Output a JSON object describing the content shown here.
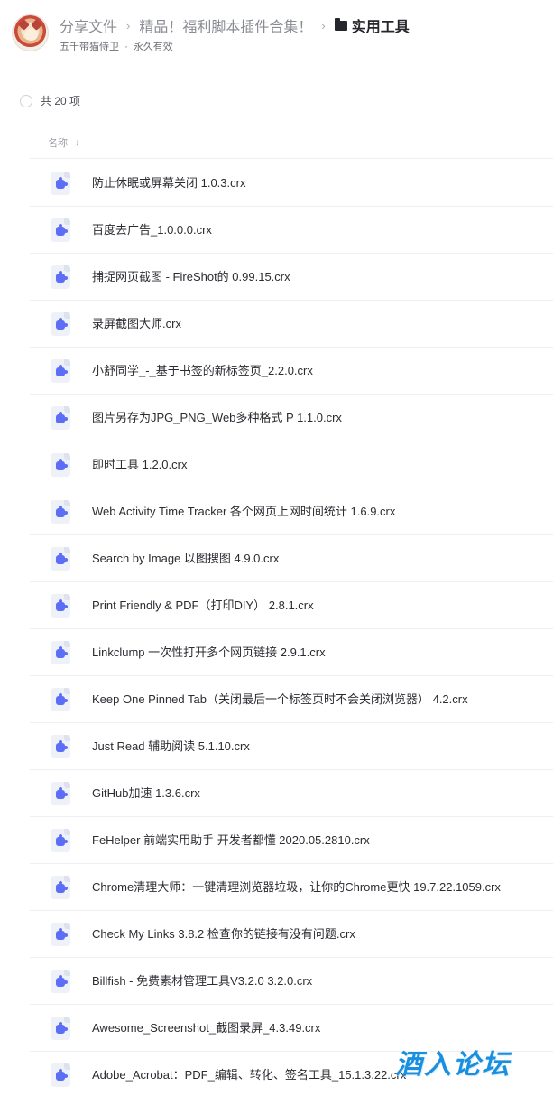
{
  "breadcrumb": {
    "items": [
      "分享文件",
      "精品！福利脚本插件合集！"
    ],
    "separator": "›",
    "current": "实用工具"
  },
  "owner": {
    "name": "五千带猫侍卫",
    "dot": "·",
    "validity": "永久有效"
  },
  "summary": {
    "count_label": "共 20 项"
  },
  "columns": {
    "name_label": "名称",
    "sort_icon": "↓"
  },
  "files": [
    {
      "name": "防止休眠或屏幕关闭 1.0.3.crx"
    },
    {
      "name": "百度去广告_1.0.0.0.crx"
    },
    {
      "name": "捕捉网页截图 - FireShot的 0.99.15.crx"
    },
    {
      "name": "录屏截图大师.crx"
    },
    {
      "name": "小舒同学_-_基于书签的新标签页_2.2.0.crx"
    },
    {
      "name": "图片另存为JPG_PNG_Web多种格式 P 1.1.0.crx"
    },
    {
      "name": "即时工具 1.2.0.crx"
    },
    {
      "name": "Web Activity Time Tracker 各个网页上网时间统计 1.6.9.crx"
    },
    {
      "name": "Search by Image 以图搜图 4.9.0.crx"
    },
    {
      "name": "Print Friendly & PDF（打印DIY） 2.8.1.crx"
    },
    {
      "name": "Linkclump 一次性打开多个网页链接 2.9.1.crx"
    },
    {
      "name": "Keep One Pinned Tab（关闭最后一个标签页时不会关闭浏览器） 4.2.crx"
    },
    {
      "name": "Just Read 辅助阅读 5.1.10.crx"
    },
    {
      "name": "GitHub加速 1.3.6.crx"
    },
    {
      "name": "FeHelper 前端实用助手 开发者都懂 2020.05.2810.crx"
    },
    {
      "name": "Chrome清理大师：一键清理浏览器垃圾，让你的Chrome更快 19.7.22.1059.crx"
    },
    {
      "name": "Check My Links 3.8.2 检查你的链接有没有问题.crx"
    },
    {
      "name": "Billfish - 免费素材管理工具V3.2.0 3.2.0.crx"
    },
    {
      "name": "Awesome_Screenshot_截图录屏_4.3.49.crx"
    },
    {
      "name": "Adobe_Acrobat：PDF_编辑、转化、签名工具_15.1.3.22.crx"
    }
  ],
  "watermark": {
    "text": "酒入论坛"
  },
  "icons": {
    "file": "extension-file-icon",
    "folder": "folder-icon",
    "avatar": "avatar"
  },
  "colors": {
    "accent": "#5b6ef5",
    "watermark": "#1a8fe0",
    "text": "#25262b",
    "muted": "#8a8c93"
  }
}
